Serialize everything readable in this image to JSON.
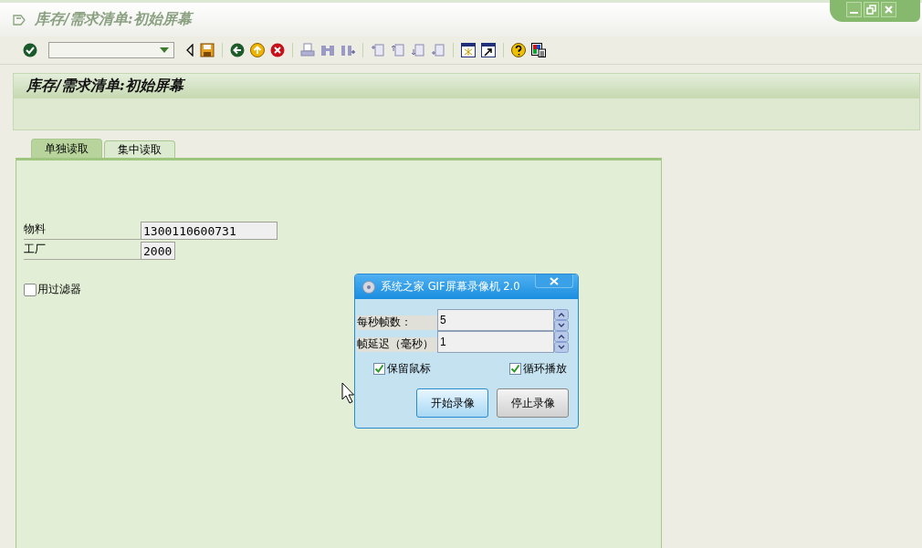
{
  "window": {
    "title": "库存/需求清单:初始屏幕"
  },
  "page": {
    "title": "库存/需求清单:初始屏幕"
  },
  "tabs": [
    {
      "label": "单独读取",
      "selected": true
    },
    {
      "label": "集中读取",
      "selected": false
    }
  ],
  "fields": [
    {
      "label": "物料",
      "value": "1300110600731"
    },
    {
      "label": "工厂",
      "value": "2000"
    }
  ],
  "filter_checkbox": {
    "label": "用过滤器",
    "checked": false
  },
  "dialog": {
    "title": "系统之家 GIF屏幕录像机 2.0",
    "spinners": [
      {
        "label": "每秒帧数：",
        "value": "5"
      },
      {
        "label": "帧延迟（毫秒）",
        "value": "1"
      }
    ],
    "options": [
      {
        "label": "保留鼠标",
        "checked": true
      },
      {
        "label": "循环播放",
        "checked": true
      }
    ],
    "buttons": [
      {
        "label": "开始录像",
        "kind": "default"
      },
      {
        "label": "停止录像",
        "kind": "normal"
      }
    ]
  }
}
